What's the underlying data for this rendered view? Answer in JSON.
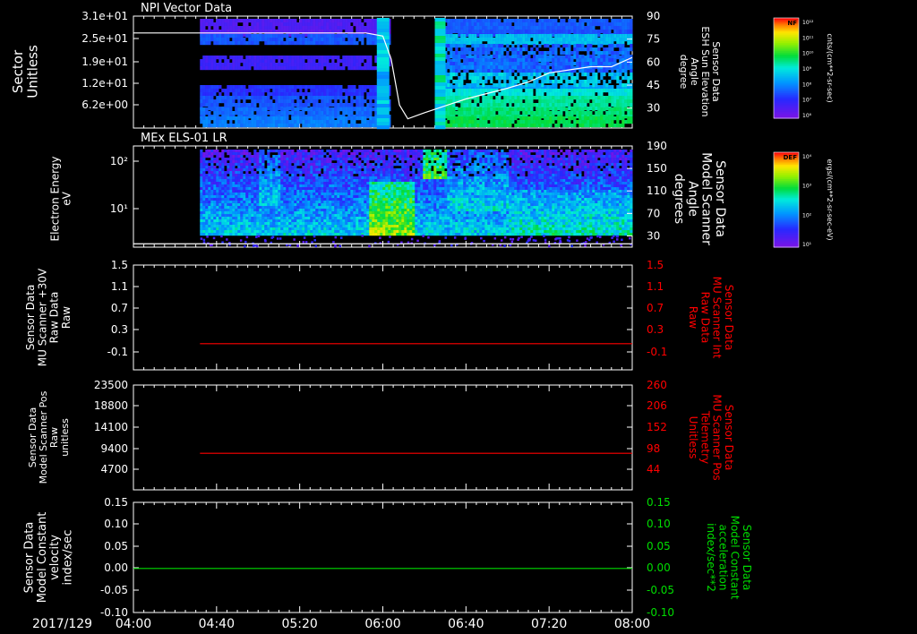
{
  "date_label": "2017/129",
  "time_ticks": [
    "04:00",
    "04:40",
    "05:20",
    "06:00",
    "06:40",
    "07:20",
    "08:00"
  ],
  "colors": {
    "frame": "#ffffff",
    "trace_red": "#ff0000",
    "trace_green": "#00dd00",
    "background": "#000000"
  },
  "colorbars": [
    {
      "tag": "NF",
      "unit": "cnts/(cm**2-sr-sec)",
      "tick_labels": [
        "10¹²",
        "10¹¹",
        "10¹⁰",
        "10⁹",
        "10⁸",
        "10⁷",
        "10⁶"
      ]
    },
    {
      "tag": "DEF",
      "unit": "ergs/(cm**2-sr-sec-eV)",
      "tick_labels": [
        "10⁴",
        "10³",
        "10²",
        "10¹"
      ]
    }
  ],
  "chart_data": [
    {
      "type": "heatmap",
      "title": "NPI Vector Data",
      "ylabel_lines": [
        "Sector",
        "Unitless"
      ],
      "y_ticks": [
        "3.1e+01",
        "2.5e+01",
        "1.9e+01",
        "1.2e+01",
        "6.2e+00"
      ],
      "right_axis": {
        "ticks": [
          "90",
          "75",
          "60",
          "45",
          "30"
        ],
        "label_lines": [
          "Sensor Data",
          "ESH Sun Elevation",
          "Angle",
          "degree"
        ],
        "color": "#ffffff"
      },
      "overlay_line": {
        "name": "ESH Sun Elevation Angle",
        "x": [
          "04:00",
          "05:40",
          "05:52",
          "06:00",
          "06:04",
          "06:08",
          "06:12",
          "06:20",
          "06:40",
          "07:00",
          "07:10",
          "07:20",
          "07:40",
          "07:50",
          "08:00"
        ],
        "y": [
          79,
          79,
          79,
          77,
          62,
          32,
          23,
          27,
          36,
          43,
          47,
          53,
          57,
          57,
          63
        ]
      }
    },
    {
      "type": "heatmap",
      "title": "MEx ELS-01 LR",
      "ylabel_lines": [
        "Electron Energy",
        "eV"
      ],
      "y_ticks": [
        "10²",
        "10¹"
      ],
      "right_axis": {
        "ticks": [
          "190",
          "150",
          "110",
          "70",
          "30"
        ],
        "label_lines": [
          "Sensor Data",
          "Model Scanner",
          "Angle",
          "degrees"
        ],
        "color": "#ffffff"
      },
      "overlay_line": {
        "name": "Model Scanner Angle",
        "x": [
          "04:00",
          "08:00"
        ],
        "y": [
          16,
          16
        ]
      }
    },
    {
      "type": "line",
      "ylabel_lines": [
        "Sensor Data",
        "MU Scanner +30V",
        "Raw Data",
        "Raw"
      ],
      "y_ticks": [
        "1.5",
        "1.1",
        "0.7",
        "0.3",
        "-0.1"
      ],
      "ylim": [
        -0.5,
        1.5
      ],
      "right_axis": {
        "ticks": [
          "1.5",
          "1.1",
          "0.7",
          "0.3",
          "-0.1"
        ],
        "label_lines": [
          "Sensor Data",
          "MU Scanner Int",
          "Raw Data",
          "Raw"
        ],
        "color": "#ff0000"
      },
      "series": [
        {
          "name": "MU Scanner Int Raw Data",
          "x": [
            "04:32",
            "08:00"
          ],
          "y": [
            0.0,
            0.0
          ],
          "color": "#ff0000"
        }
      ]
    },
    {
      "type": "line",
      "ylabel_lines": [
        "Sensor Data",
        "Model Scanner Pos",
        "Raw",
        "unitless"
      ],
      "y_ticks": [
        "23500",
        "18800",
        "14100",
        "9400",
        "4700"
      ],
      "ylim": [
        0,
        23500
      ],
      "right_axis": {
        "ticks": [
          "260",
          "206",
          "152",
          "98",
          "44"
        ],
        "label_lines": [
          "Sensor Data",
          "MU Scanner Pos",
          "Telemetry",
          "Unitless"
        ],
        "color": "#ff0000"
      },
      "series": [
        {
          "name": "MU Scanner Pos Telemetry",
          "x": [
            "04:32",
            "08:00"
          ],
          "y": [
            8200,
            8200
          ],
          "color": "#ff0000"
        }
      ]
    },
    {
      "type": "line",
      "ylabel_lines": [
        "Sensor Data",
        "Model Constant",
        "velocity",
        "index/sec"
      ],
      "y_ticks": [
        "0.15",
        "0.10",
        "0.05",
        "0.00",
        "-0.05",
        "-0.10"
      ],
      "ylim": [
        -0.1,
        0.15
      ],
      "right_axis": {
        "ticks": [
          "0.15",
          "0.10",
          "0.05",
          "0.00",
          "-0.05",
          "-0.10"
        ],
        "label_lines": [
          "Sensor Data",
          "Model Constant",
          "acceleration",
          "index/sec**2"
        ],
        "color": "#00dd00"
      },
      "series": [
        {
          "name": "Model Constant acceleration",
          "x": [
            "04:00",
            "08:00"
          ],
          "y": [
            0.0,
            0.0
          ],
          "color": "#00dd00"
        }
      ]
    }
  ]
}
